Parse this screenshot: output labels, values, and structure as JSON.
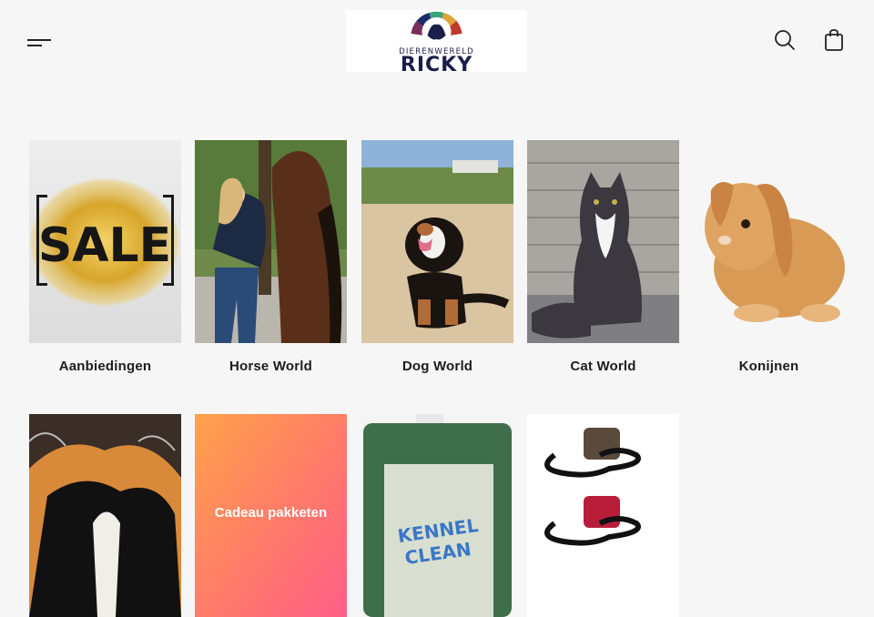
{
  "header": {
    "logo_top": "DIERENWERELD",
    "logo_main": "RICKY"
  },
  "icons": {
    "menu": "menu-icon",
    "search": "search-icon",
    "bag": "shopping-bag-icon"
  },
  "collections": [
    {
      "label": "Aanbiedingen"
    },
    {
      "label": "Horse World"
    },
    {
      "label": "Dog World"
    },
    {
      "label": "Cat World"
    },
    {
      "label": "Konijnen"
    }
  ],
  "collections_row2": [
    {
      "label": ""
    },
    {
      "label": "Cadeau pakketen"
    },
    {
      "label": ""
    },
    {
      "label": ""
    }
  ],
  "images": {
    "sale_text": "SALE",
    "kennel_text_1": "KENNEL",
    "kennel_text_2": "CLEAN"
  }
}
